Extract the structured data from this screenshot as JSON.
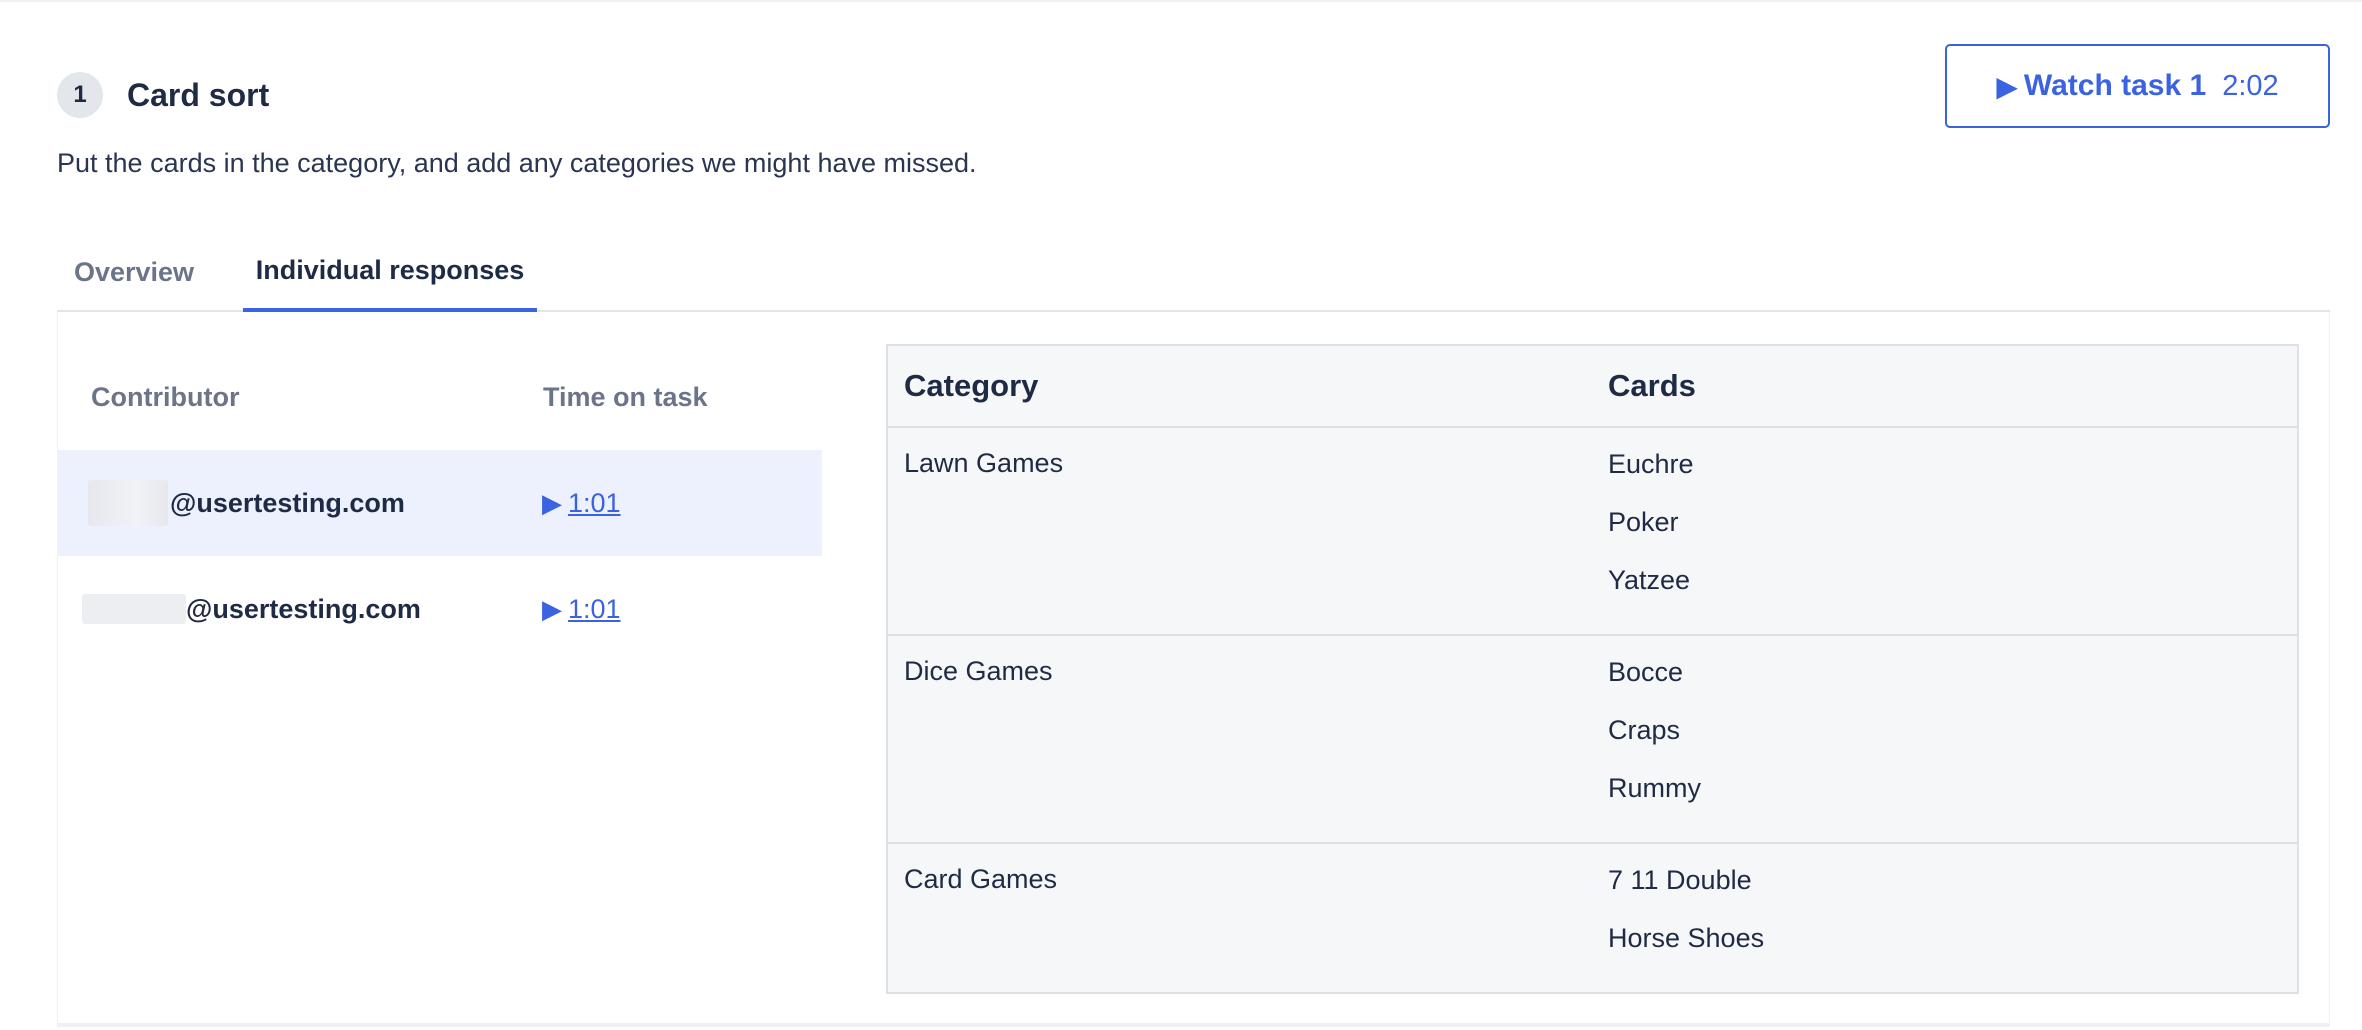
{
  "task": {
    "number": "1",
    "title": "Card sort",
    "description": "Put the cards in the category, and add any categories we might have missed."
  },
  "watch_button": {
    "label": "Watch task 1",
    "duration": "2:02"
  },
  "tabs": [
    {
      "label": "Overview",
      "active": false
    },
    {
      "label": "Individual responses",
      "active": true
    }
  ],
  "contributors": {
    "headers": {
      "contributor": "Contributor",
      "time_on_task": "Time on task"
    },
    "rows": [
      {
        "email": "@usertesting.com",
        "time": "1:01",
        "selected": true
      },
      {
        "email": "@usertesting.com",
        "time": "1:01",
        "selected": false
      }
    ]
  },
  "categories": {
    "headers": {
      "category": "Category",
      "cards": "Cards"
    },
    "rows": [
      {
        "name": "Lawn Games",
        "cards": [
          "Euchre",
          "Poker",
          "Yatzee"
        ]
      },
      {
        "name": "Dice Games",
        "cards": [
          "Bocce",
          "Craps",
          "Rummy"
        ]
      },
      {
        "name": "Card Games",
        "cards": [
          "7 11 Double",
          "Horse Shoes"
        ]
      }
    ]
  },
  "icons": {
    "play": "play-icon"
  },
  "colors": {
    "accent": "#3b62e0",
    "selected_row": "#ecf1fd",
    "text": "#1f2a44"
  }
}
